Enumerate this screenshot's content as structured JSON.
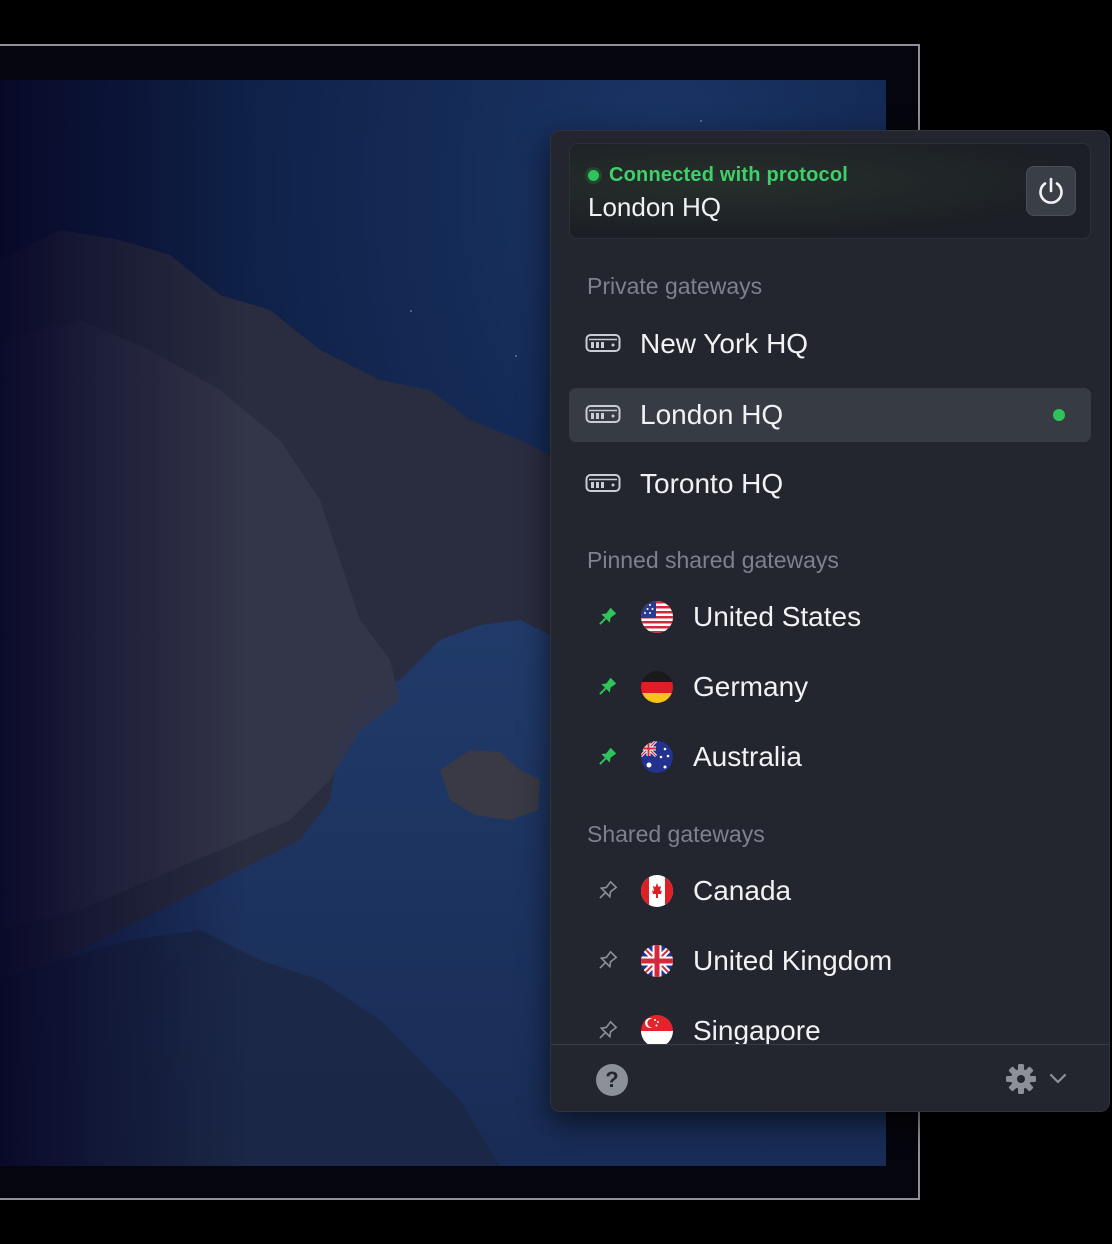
{
  "status": {
    "text": "Connected with protocol",
    "gateway": "London HQ",
    "color": "#2fc45b"
  },
  "sections": {
    "private": {
      "title": "Private gateways",
      "items": [
        {
          "label": "New York HQ",
          "icon": "server-icon"
        },
        {
          "label": "London HQ",
          "icon": "server-icon",
          "selected": true
        },
        {
          "label": "Toronto HQ",
          "icon": "server-icon"
        }
      ]
    },
    "pinned": {
      "title": "Pinned shared gateways",
      "items": [
        {
          "label": "United States",
          "flag": "us-flag-icon",
          "pinned": true
        },
        {
          "label": "Germany",
          "flag": "germany-flag-icon",
          "pinned": true
        },
        {
          "label": "Australia",
          "flag": "australia-flag-icon",
          "pinned": true
        }
      ]
    },
    "shared": {
      "title": "Shared gateways",
      "items": [
        {
          "label": "Canada",
          "flag": "canada-flag-icon",
          "pinned": false
        },
        {
          "label": "United Kingdom",
          "flag": "uk-flag-icon",
          "pinned": false
        },
        {
          "label": "Singapore",
          "flag": "singapore-flag-icon",
          "pinned": false
        }
      ]
    }
  },
  "footer": {
    "help_label": "?",
    "help_icon": "help-icon",
    "settings_icon": "gear-icon",
    "menu_icon": "chevron-down-icon"
  },
  "colors": {
    "accent": "#2fc45b",
    "panel": "#23262e",
    "selected_row": "#373b43"
  }
}
